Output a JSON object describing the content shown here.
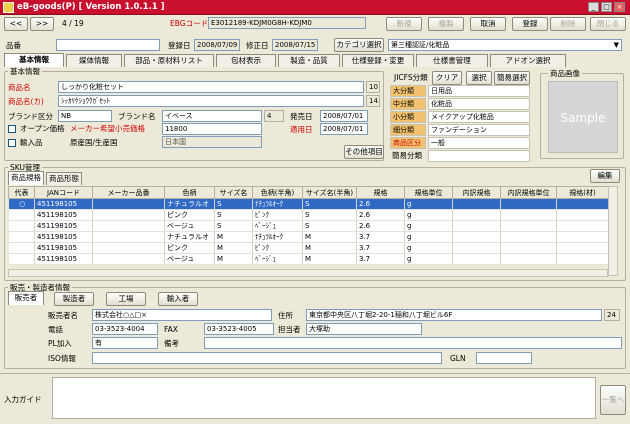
{
  "window": {
    "title": "eB-goods(P) [ Version 1.0.1.1 ]"
  },
  "nav": {
    "prev": "<<",
    "next": ">>",
    "counter": "4 / 19",
    "ebg_label": "EBGコード",
    "ebg_code": "E3012189-KDJM0G8H-KDJM0"
  },
  "toolbar": {
    "new": "新規",
    "copy": "複製",
    "cancel": "取消",
    "register": "登録",
    "delete": "削除",
    "close": "閉じる"
  },
  "header": {
    "hinban_label": "品番",
    "hinban": "",
    "reg_date_label": "登録日",
    "reg_date": "2008/07/09",
    "mod_date_label": "修正日",
    "mod_date": "2008/07/15",
    "category_button": "カテゴリ選択",
    "category_value": "第三種認証/化粧品"
  },
  "tabs": [
    "基本情報",
    "媒体情報",
    "部品・原材料リスト",
    "包材表示",
    "製造・品質",
    "仕様登録・変更",
    "仕様書管理",
    "アドオン選択"
  ],
  "basic": {
    "group_title": "基本情報",
    "name_label": "商品名",
    "name": "しっかり化粧セット",
    "name_num": "10",
    "kana_label": "商品名(カ)",
    "kana": "ｼｯｶﾘｹｼｮｳｸｶﾞｾｯﾄ",
    "kana_num": "14",
    "brand_div_label": "ブランド区分",
    "brand_div": "NB",
    "brand_label": "ブランド名",
    "brand": "イベース",
    "brand_num": "4",
    "release_label": "発売日",
    "release": "2008/07/01",
    "open_price_label": "オープン価格",
    "maker_price_label": "メーカー希望小売価格",
    "maker_price": "11800",
    "apply_label": "適用日",
    "apply": "2008/07/01",
    "import_label": "輸入品",
    "origin_label": "原産国/生産国",
    "origin": "日本国",
    "other_button": "その他項目"
  },
  "jicfs": {
    "label": "JICFS分類",
    "clear": "クリア",
    "select": "選択",
    "simple": "簡易選択",
    "rows": [
      {
        "label": "大分類",
        "value": "日用品"
      },
      {
        "label": "中分類",
        "value": "化粧品"
      },
      {
        "label": "小分類",
        "value": "メイクアップ化粧品"
      },
      {
        "label": "細分類",
        "value": "ファンデーション"
      }
    ],
    "prod_div_label": "商品区分",
    "prod_div": "一般",
    "simple_label": "簡易分類",
    "simple_value": ""
  },
  "image": {
    "title": "商品画像",
    "placeholder": "Sample"
  },
  "sku": {
    "group_title": "SKU管理",
    "tab1": "商品規格",
    "tab2": "商品形態",
    "edit": "編集",
    "columns": [
      "代表",
      "JANコード",
      "メーカー品番",
      "色柄",
      "サイズ名",
      "色柄(半角)",
      "サイズ名(半角)",
      "規格",
      "規格単位",
      "内訳規格",
      "内訳規格単位",
      "規格(材)"
    ],
    "rows": [
      [
        "○",
        "451198105",
        "",
        "ナチュラルオ",
        "S",
        "ﾅﾁｭﾗﾙｵｰｸ",
        "S",
        "2.6",
        "g",
        "",
        "",
        ""
      ],
      [
        "",
        "451198105",
        "",
        "ピンク",
        "S",
        "ﾋﾟﾝｸ",
        "S",
        "2.6",
        "g",
        "",
        "",
        ""
      ],
      [
        "",
        "451198105",
        "",
        "ベージュ",
        "S",
        "ﾍﾞｰｼﾞｭ",
        "S",
        "2.6",
        "g",
        "",
        "",
        ""
      ],
      [
        "",
        "451198105",
        "",
        "ナチュラルオ",
        "M",
        "ﾅﾁｭﾗﾙｵｰｸ",
        "M",
        "3.7",
        "g",
        "",
        "",
        ""
      ],
      [
        "",
        "451198105",
        "",
        "ピンク",
        "M",
        "ﾋﾟﾝｸ",
        "M",
        "3.7",
        "g",
        "",
        "",
        ""
      ],
      [
        "",
        "451198105",
        "",
        "ベージュ",
        "M",
        "ﾍﾞｰｼﾞｭ",
        "M",
        "3.7",
        "g",
        "",
        "",
        ""
      ]
    ]
  },
  "seller": {
    "group_title": "販売・製造者情報",
    "tabs": [
      "販売者",
      "製造者",
      "工場",
      "輸入者"
    ],
    "name_label": "販売者名",
    "name": "株式会社○△□×",
    "addr_label": "住所",
    "addr": "東京都中央区八丁堀2-20-1稲和八丁堀ビル6F",
    "addr_num": "24",
    "tel_label": "電話",
    "tel": "03-3523-4004",
    "fax_label": "FAX",
    "fax": "03-3523-4005",
    "contact_label": "担当者",
    "contact": "大塚助",
    "pl_label": "PL加入",
    "pl": "有",
    "note_label": "備考",
    "note": "",
    "iso_label": "ISO情報",
    "iso": "",
    "gln_label": "GLN",
    "gln": ""
  },
  "footer": {
    "guide_label": "入力ガイド",
    "back": "一覧へ"
  }
}
